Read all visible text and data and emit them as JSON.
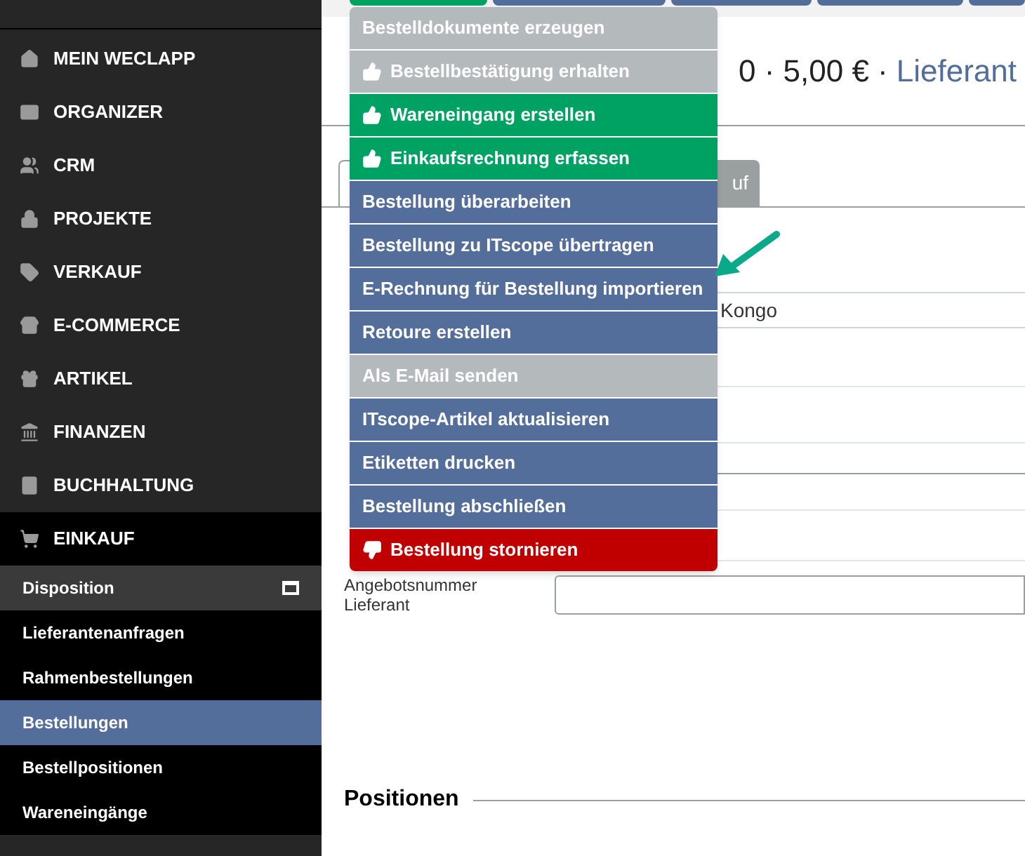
{
  "sidebar": {
    "items": [
      {
        "label": "MEIN WECLAPP"
      },
      {
        "label": "ORGANIZER"
      },
      {
        "label": "CRM"
      },
      {
        "label": "PROJEKTE"
      },
      {
        "label": "VERKAUF"
      },
      {
        "label": "E-COMMERCE"
      },
      {
        "label": "ARTIKEL"
      },
      {
        "label": "FINANZEN"
      },
      {
        "label": "BUCHHALTUNG"
      },
      {
        "label": "EINKAUF",
        "expanded": true,
        "children": [
          {
            "label": "Disposition",
            "selected": false,
            "hovered": true
          },
          {
            "label": "Lieferantenanfragen",
            "selected": false,
            "hovered": false
          },
          {
            "label": "Rahmenbestellungen",
            "selected": false,
            "hovered": false
          },
          {
            "label": "Bestellungen",
            "selected": true,
            "hovered": false
          },
          {
            "label": "Bestellpositionen",
            "selected": false,
            "hovered": false
          },
          {
            "label": "Wareneingänge",
            "selected": false,
            "hovered": false
          }
        ]
      }
    ]
  },
  "header": {
    "summary": "0 · 5,00 € ·",
    "link": "Lieferant"
  },
  "tabs": [
    {
      "selected": true
    },
    {
      "label": "uf",
      "selected": false
    }
  ],
  "menu": [
    {
      "label": "Bestelldokumente erzeugen",
      "kind": "disabled"
    },
    {
      "label": "Bestellbestätigung erhalten",
      "kind": "disabled"
    },
    {
      "label": "Wareneingang erstellen",
      "kind": "positive"
    },
    {
      "label": "Einkaufsrechnung erfassen",
      "kind": "positive"
    },
    {
      "label": "Bestellung überarbeiten",
      "kind": "normal"
    },
    {
      "label": "Bestellung zu ITscope übertragen",
      "kind": "normal"
    },
    {
      "label": "E-Rechnung für Bestellung importieren",
      "kind": "normal"
    },
    {
      "label": "Retoure erstellen",
      "kind": "normal"
    },
    {
      "label": "Als E-Mail senden",
      "kind": "disabled"
    },
    {
      "label": "ITscope-Artikel aktualisieren",
      "kind": "normal"
    },
    {
      "label": "Etiketten drucken",
      "kind": "normal"
    },
    {
      "label": "Bestellung abschließen",
      "kind": "normal"
    },
    {
      "label": "Bestellung stornieren",
      "kind": "danger"
    }
  ],
  "form": {
    "field_value": "Kongo",
    "offer_label": "Angebotsnummer Lieferant"
  },
  "section": "Positionen"
}
